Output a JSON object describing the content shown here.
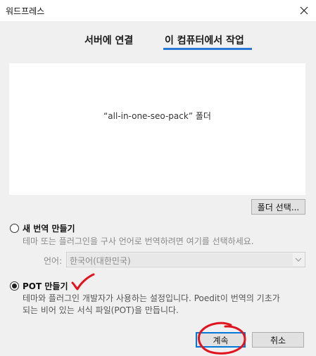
{
  "window": {
    "title": "워드프레스",
    "close_icon": "close-icon"
  },
  "tabs": [
    {
      "label": "서버에 연결",
      "active": false
    },
    {
      "label": "이 컴퓨터에서 작업",
      "active": true
    }
  ],
  "preview": {
    "folder_text": "“all-in-one-seo-pack” 폴더"
  },
  "folder_button": {
    "label": "폴더 선택..."
  },
  "option_new": {
    "label": "새 번역 만들기",
    "selected": false,
    "description": "테마 또는 플러그인을 구사 언어로 번역하려면 여기를 선택하세요.",
    "language_label": "언어:",
    "language_value": "한국어(대한민국)"
  },
  "option_pot": {
    "label": "POT 만들기",
    "selected": true,
    "description_line1": "테마와 플러그인 개발자가 사용하는 설정입니다. Poedit이 번역의 기초가",
    "description_line2": "되는 비어 있는 서식 파일(POT)을 만듭니다."
  },
  "buttons": {
    "continue": "계속",
    "cancel": "취소"
  },
  "colors": {
    "accent": "#2b78d4",
    "annotation": "#e0131f"
  }
}
